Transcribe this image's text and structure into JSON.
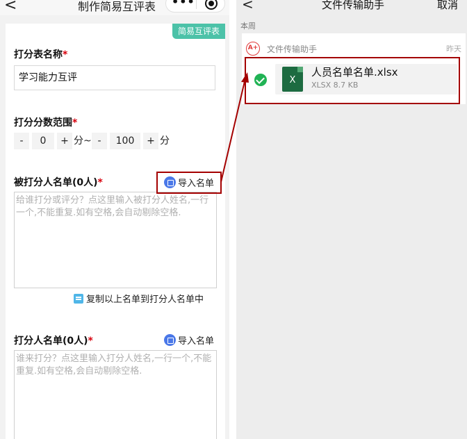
{
  "left": {
    "nav": {
      "back": "<",
      "title": "制作简易互评表",
      "more": "•••"
    },
    "tag": "简易互评表",
    "form_name": {
      "label": "打分表名称",
      "required": "*",
      "value": "学习能力互评"
    },
    "score_range": {
      "label": "打分分数范围",
      "required": "*",
      "min_minus": "-",
      "min_value": "0",
      "min_plus": "+",
      "min_unit": "分~",
      "max_minus": "-",
      "max_value": "100",
      "max_plus": "+",
      "max_unit": "分"
    },
    "ratees": {
      "label": "被打分人名单(0人)",
      "required": "*",
      "import_label": "导入名单",
      "placeholder": "给谁打分或评分？点这里输入被打分人姓名,一行一个,不能重复.如有空格,会自动剔除空格.",
      "copy_label": "复制以上名单到打分人名单中"
    },
    "raters": {
      "label": "打分人名单(0人)",
      "required": "*",
      "import_label": "导入名单",
      "placeholder": "谁来打分？点这里输入打分人姓名,一行一个,不能重复.如有空格,会自动剔除空格."
    }
  },
  "right": {
    "nav": {
      "back": "<",
      "title": "文件传输助手",
      "cancel": "取消"
    },
    "section": "本周",
    "sender": {
      "avatar": "A+",
      "name": "文件传输助手",
      "time": "昨天"
    },
    "file": {
      "icon": "X",
      "name": "人员名单名单.xlsx",
      "meta": "XLSX 8.7 KB"
    }
  },
  "colors": {
    "tag": "#4cc2a8",
    "required": "#d8000c",
    "highlight": "#a40000",
    "excel": "#1d6b41",
    "check": "#21b355"
  }
}
